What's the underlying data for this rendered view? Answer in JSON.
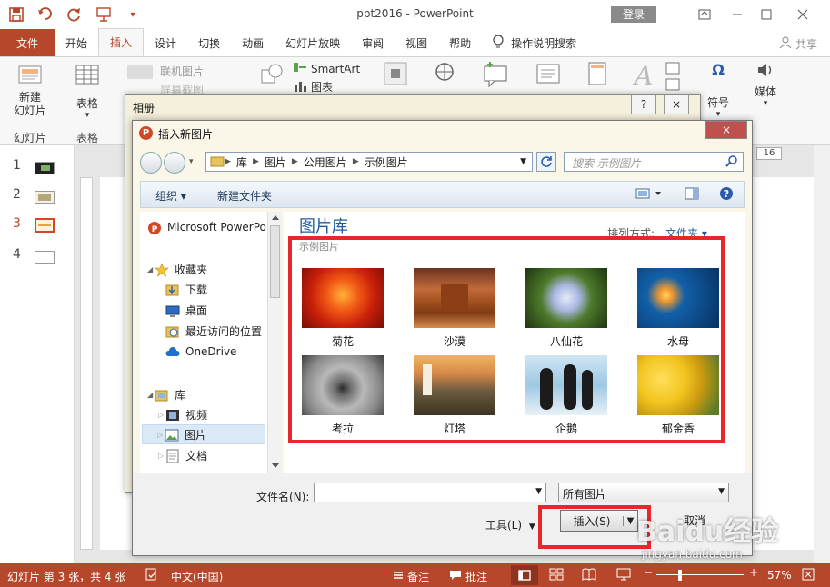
{
  "window": {
    "title": "ppt2016  -  PowerPoint",
    "login_label": "登录",
    "share_label": "共享"
  },
  "ribbon": {
    "tabs": [
      "文件",
      "开始",
      "插入",
      "设计",
      "切换",
      "动画",
      "幻灯片放映",
      "审阅",
      "视图",
      "帮助",
      "操作说明搜索"
    ],
    "active_tab": "插入",
    "new_slide_label": "新建\n幻灯片",
    "slides_group_label": "幻灯片",
    "table_label": "表格",
    "table_group_label": "表格",
    "online_pictures_label": "联机图片",
    "screenshot_label": "屏幕截图",
    "smartart_label": "SmartArt",
    "chart_label": "图表",
    "symbol_label": "符号",
    "media_label": "媒体"
  },
  "slides": [
    {
      "num": "1"
    },
    {
      "num": "2"
    },
    {
      "num": "3"
    },
    {
      "num": "4"
    }
  ],
  "zoom_right": "16",
  "album_dialog": {
    "title": "相册",
    "help": "?",
    "close": "×"
  },
  "insert_dialog": {
    "title": "插入新图片",
    "close": "×",
    "breadcrumb": [
      "库",
      "图片",
      "公用图片",
      "示例图片"
    ],
    "search_placeholder": "搜索 示例图片",
    "organize_label": "组织 ▾",
    "new_folder_label": "新建文件夹",
    "nav": {
      "items": [
        {
          "label": "Microsoft PowerPoint",
          "icon": "powerpoint-icon"
        },
        {
          "label": "收藏夹",
          "icon": "star-icon"
        },
        {
          "label": "下载",
          "icon": "download-folder-icon"
        },
        {
          "label": "桌面",
          "icon": "desktop-icon"
        },
        {
          "label": "最近访问的位置",
          "icon": "recent-icon"
        },
        {
          "label": "OneDrive",
          "icon": "cloud-icon"
        },
        {
          "label": "库",
          "icon": "library-icon"
        },
        {
          "label": "视频",
          "icon": "video-icon"
        },
        {
          "label": "图片",
          "icon": "pictures-icon"
        },
        {
          "label": "文档",
          "icon": "documents-icon"
        }
      ]
    },
    "library_title": "图片库",
    "library_subtitle": "示例图片",
    "sort_label": "排列方式:",
    "sort_value": "文件夹 ▾",
    "photos": [
      "菊花",
      "沙漠",
      "八仙花",
      "水母",
      "考拉",
      "灯塔",
      "企鹅",
      "郁金香"
    ],
    "filename_label": "文件名(N):",
    "filename_value": "",
    "filetype_value": "所有图片",
    "tools_label": "工具(L)",
    "insert_label": "插入(S)",
    "cancel_label": "取消"
  },
  "status": {
    "slide_info": "幻灯片 第 3 张，共 4 张",
    "language": "中文(中国)",
    "notes": "备注",
    "comments": "批注",
    "zoom": "57%"
  },
  "watermark": {
    "text": "Baidu经验",
    "url": "jingyan.baidu.com"
  },
  "colors": {
    "accent": "#b7472a",
    "highlight": "#e8272c"
  }
}
